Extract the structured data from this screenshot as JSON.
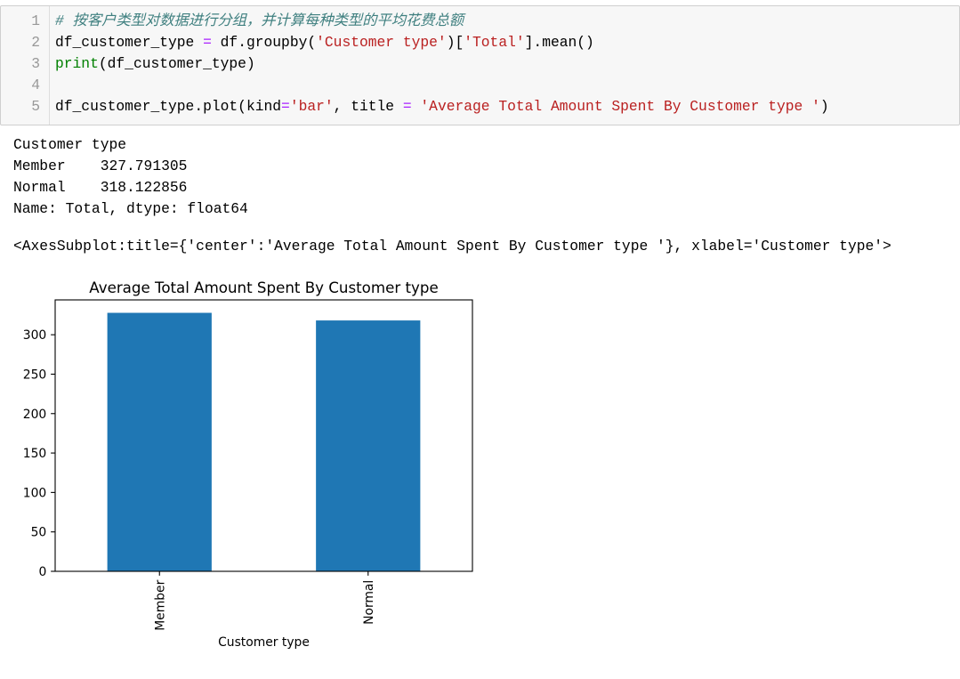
{
  "theme": {
    "comment": "#408080",
    "string": "#ba2121",
    "operator": "#aa22ff",
    "builtin": "#008000",
    "text": "#000000",
    "line_number": "#999999",
    "cell_background": "#f7f7f7",
    "cell_border": "#cfcfcf"
  },
  "code_cell": {
    "line_numbers": [
      "1",
      "2",
      "3",
      "4",
      "5"
    ],
    "lines": [
      [
        "# 按客户类型对数据进行分组，并计算每种类型的平均花费总额"
      ],
      [
        "df_customer_type ",
        "=",
        " df.groupby(",
        "'Customer type'",
        ")[",
        "'Total'",
        "].mean()"
      ],
      [
        "print",
        "(df_customer_type)"
      ],
      [],
      [
        "df_customer_type.plot(kind",
        "=",
        "'bar'",
        ", title ",
        "=",
        " ",
        "'Average Total Amount Spent By Customer type '",
        ")"
      ]
    ]
  },
  "output": {
    "stdout": [
      "Customer type",
      "Member    327.791305",
      "Normal    318.122856",
      "Name: Total, dtype: float64"
    ],
    "execute_result": "<AxesSubplot:title={'center':'Average Total Amount Spent By Customer type '}, xlabel='Customer type'>"
  },
  "chart_data": {
    "type": "bar",
    "title": "Average Total Amount Spent By Customer type",
    "xlabel": "Customer type",
    "categories": [
      "Member",
      "Normal"
    ],
    "values": [
      327.791305,
      318.122856
    ],
    "ylim": [
      0,
      344.18
    ],
    "yticks": [
      0,
      50,
      100,
      150,
      200,
      250,
      300
    ],
    "xtick_label_orientation": "vertical",
    "grid": false,
    "legend": "none",
    "bar_color": "#1f77b4"
  }
}
